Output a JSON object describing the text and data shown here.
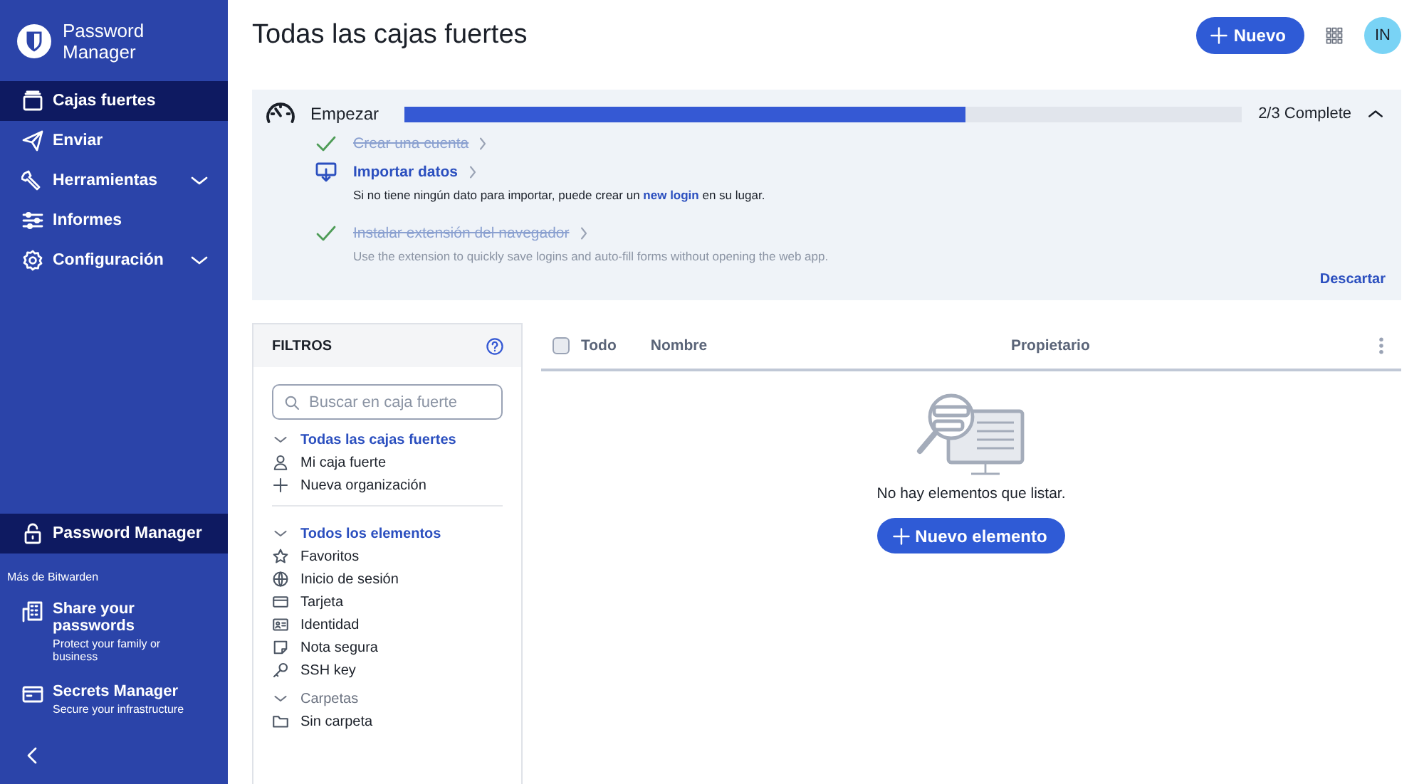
{
  "app": {
    "name": "Password Manager"
  },
  "nav": [
    {
      "label": "Cajas fuertes",
      "kind": "vault",
      "selected": true,
      "expandable": false
    },
    {
      "label": "Enviar",
      "kind": "send",
      "selected": false,
      "expandable": false
    },
    {
      "label": "Herramientas",
      "kind": "tools",
      "selected": false,
      "expandable": true
    },
    {
      "label": "Informes",
      "kind": "reports",
      "selected": false,
      "expandable": false
    },
    {
      "label": "Configuración",
      "kind": "settings",
      "selected": false,
      "expandable": true
    }
  ],
  "product": {
    "label": "Password Manager"
  },
  "more": {
    "title": "Más de Bitwarden",
    "items": [
      {
        "title": "Share your passwords",
        "subtitle": "Protect your family or business",
        "kind": "share"
      },
      {
        "title": "Secrets Manager",
        "subtitle": "Secure your infrastructure",
        "kind": "secrets"
      }
    ]
  },
  "header": {
    "title": "Todas las cajas fuertes",
    "new_button": "Nuevo",
    "avatar": "IN"
  },
  "onboarding": {
    "title": "Empezar",
    "level": 0.67,
    "reading": "2/3 Complete",
    "expanded": true,
    "tasks": [
      {
        "title": "Crear una cuenta",
        "done": true
      },
      {
        "title": "Importar datos",
        "done": false,
        "text_before": "Si no tiene ningún dato para importar, puede crear un ",
        "link": "new login",
        "text_after": " en su lugar."
      },
      {
        "title": "Instalar extensión del navegador",
        "done": true,
        "text_before": "Use the extension to quickly save logins and auto-fill forms without opening the web app."
      }
    ],
    "dismiss": "Descartar"
  },
  "filters": {
    "title": "FILTROS",
    "search_placeholder": "Buscar en caja fuerte",
    "groups": [
      {
        "title": "Todas las cajas fuertes",
        "selected": true,
        "items": [
          {
            "label": "Mi caja fuerte",
            "kind": "vault"
          },
          {
            "label": "Nueva organización",
            "kind": "new"
          }
        ]
      },
      {
        "title": "Todos los elementos",
        "selected": true,
        "items": [
          {
            "label": "Favoritos",
            "kind": "favorites"
          },
          {
            "label": "Inicio de sesión",
            "kind": "login"
          },
          {
            "label": "Tarjeta",
            "kind": "card"
          },
          {
            "label": "Identidad",
            "kind": "identity"
          },
          {
            "label": "Nota segura",
            "kind": "note"
          },
          {
            "label": "SSH key",
            "kind": "ssh"
          }
        ]
      },
      {
        "title": "Carpetas",
        "selected": false,
        "items": [
          {
            "label": "Sin carpeta",
            "kind": "folder"
          }
        ]
      }
    ]
  },
  "table": {
    "select_all": {
      "label": "Todo",
      "checked": false
    },
    "columns": [
      "Nombre",
      "Propietario"
    ],
    "empty_text": "No hay elementos que listar.",
    "new_item_button": "Nuevo elemento"
  }
}
